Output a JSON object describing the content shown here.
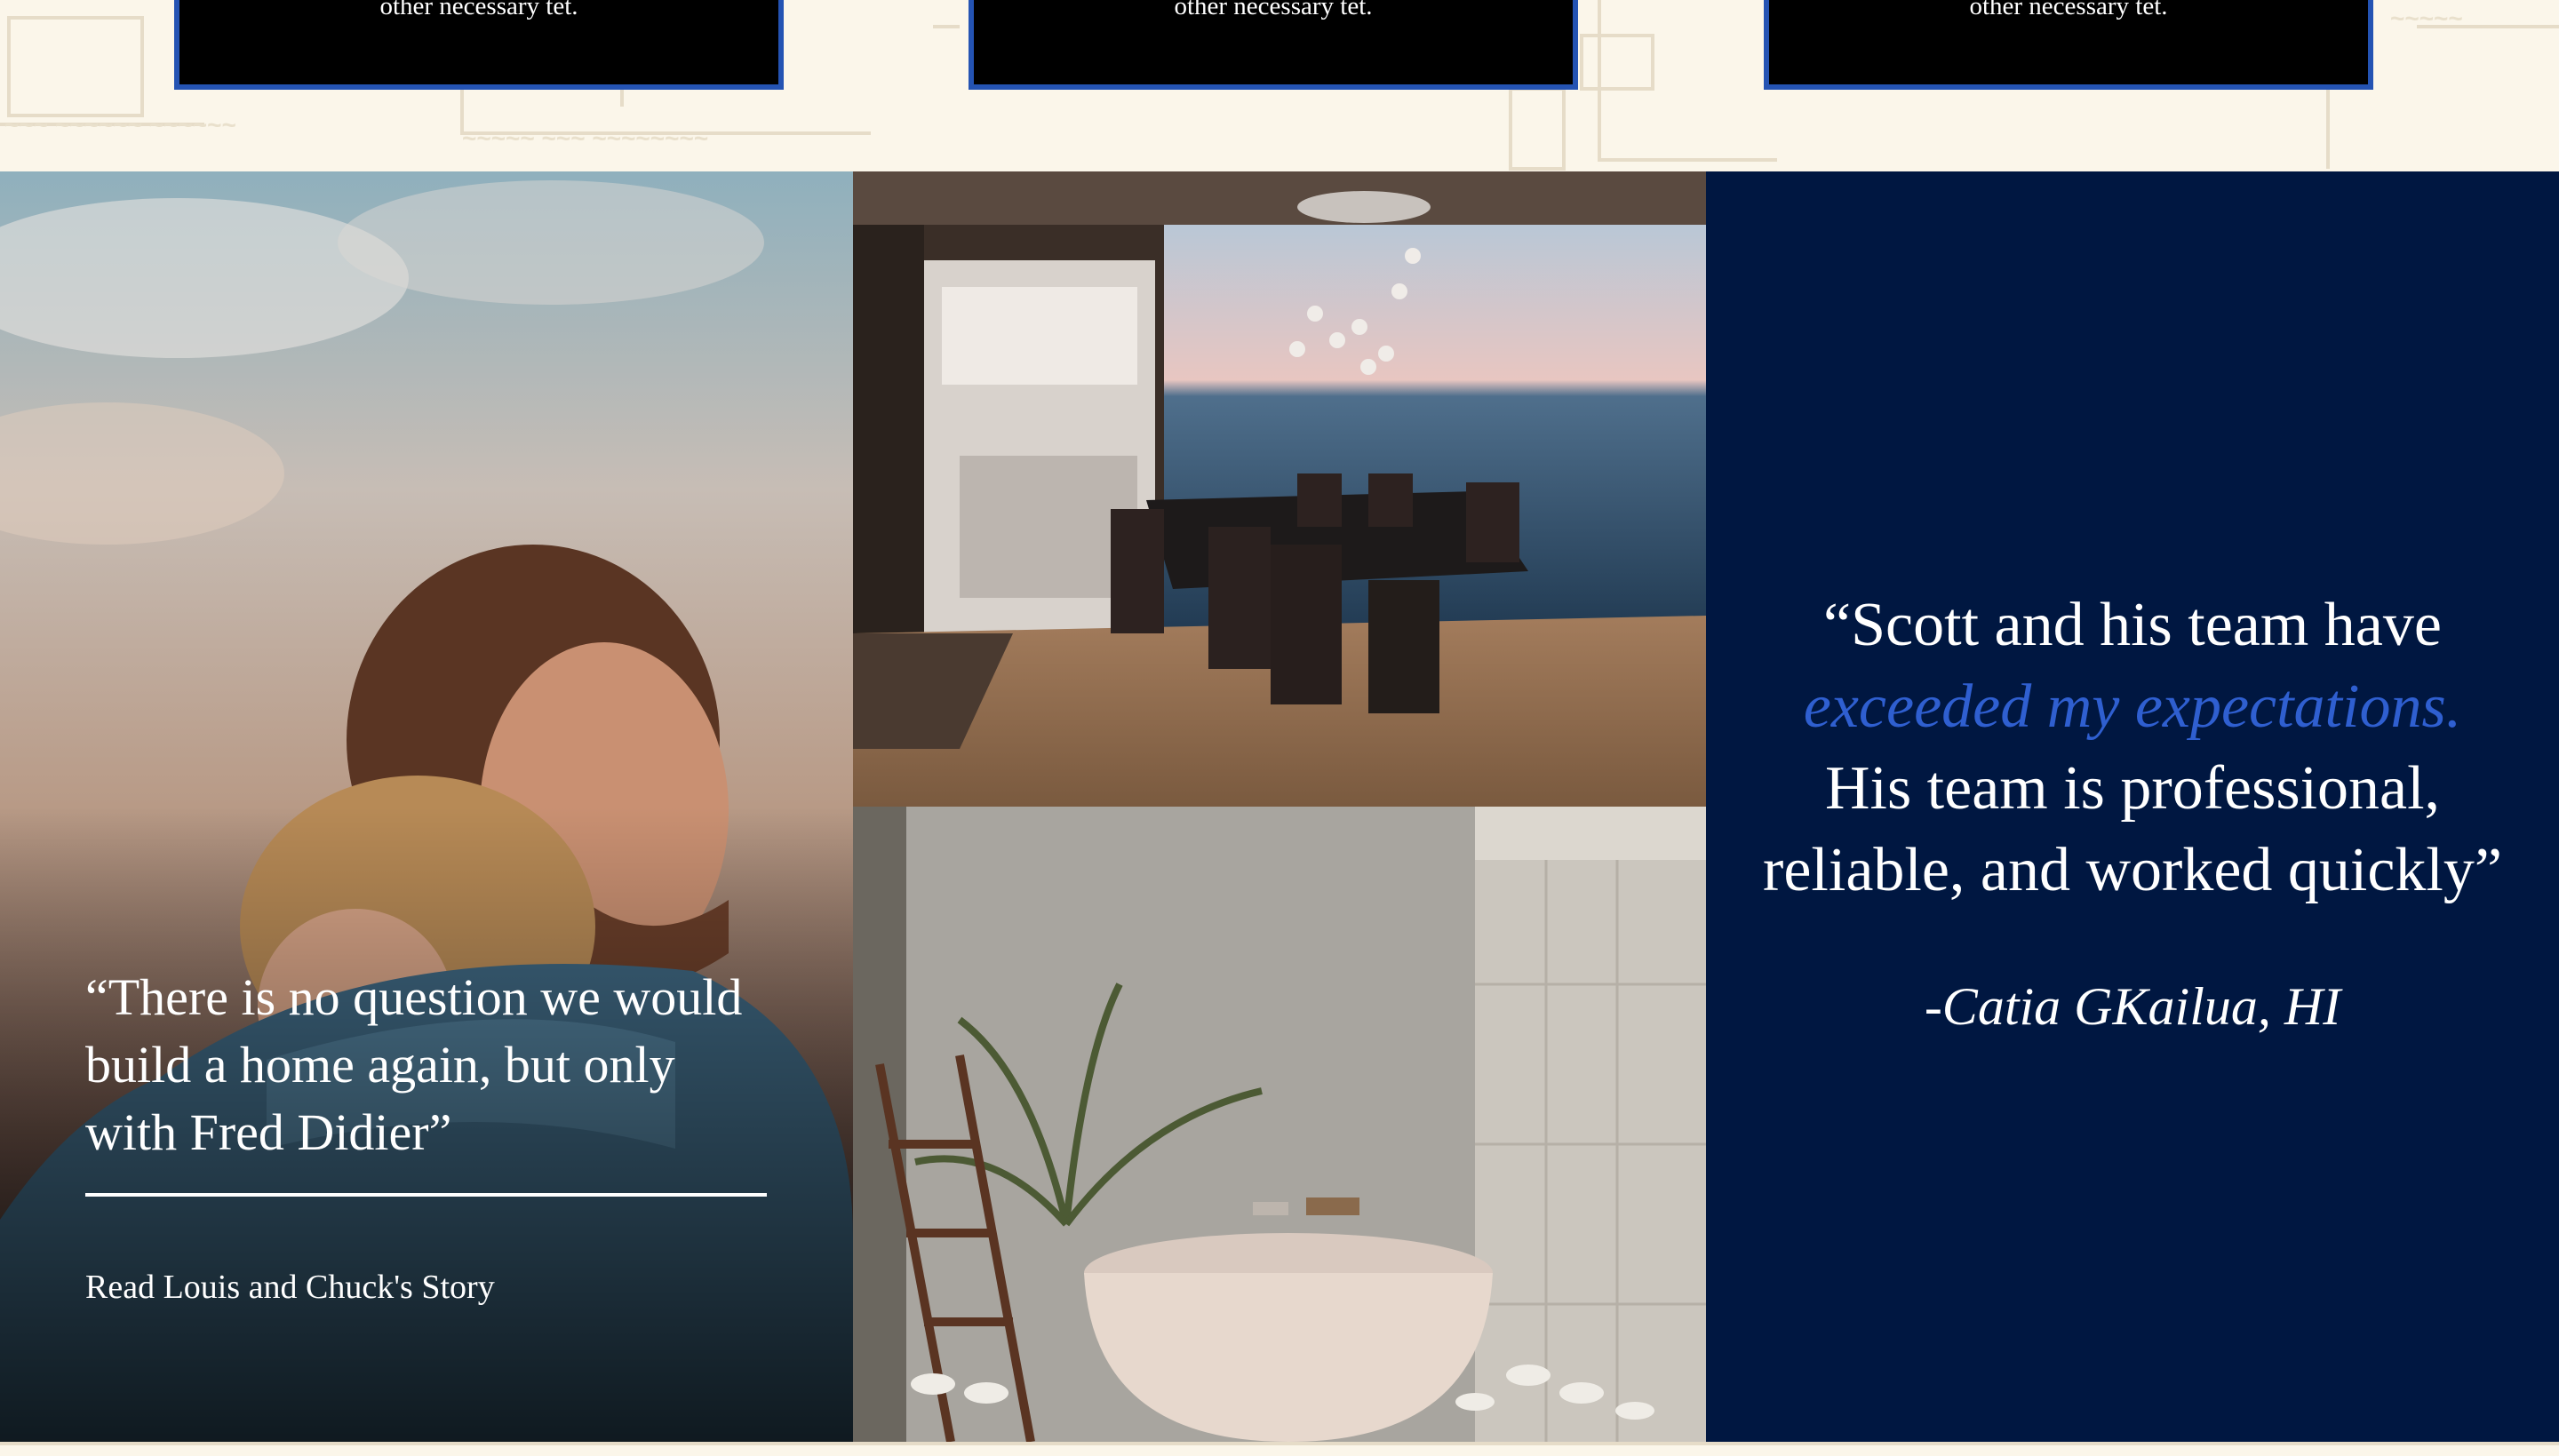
{
  "cards": [
    {
      "text": "other necessary tet."
    },
    {
      "text": "other necessary tet."
    },
    {
      "text": "other necessary tet."
    }
  ],
  "story": {
    "quote": "“There is no question we would build a home again, but only with Fred Didier”",
    "link_label": "Read Louis and Chuck's Story"
  },
  "testimonial": {
    "line1": "“Scott and his team have",
    "highlight": "exceeded my expectations.",
    "line3": "His team is professional,",
    "line4": "reliable, and worked quickly”",
    "author": "-Catia GKailua, HI"
  },
  "colors": {
    "navy": "#001741",
    "accent_blue": "#2f5fd0",
    "card_border": "#2453b3",
    "cream": "#fbf6ea"
  }
}
